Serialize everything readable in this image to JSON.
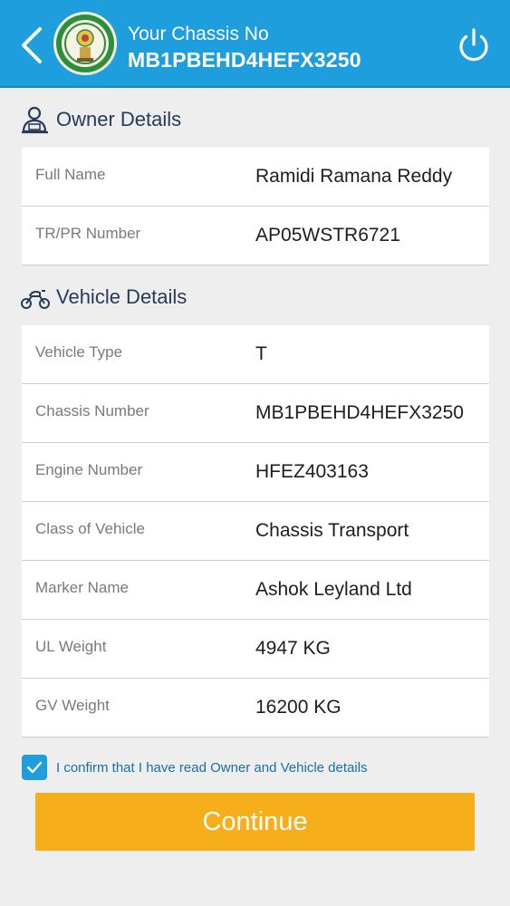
{
  "header": {
    "title": "Your Chassis No",
    "chassis_no": "MB1PBEHD4HEFX3250",
    "back_icon": "chevron-left-icon",
    "power_icon": "power-icon",
    "logo": "government-emblem-logo"
  },
  "owner": {
    "title": "Owner Details",
    "icon": "person-icon",
    "rows": [
      {
        "label": "Full Name",
        "value": "Ramidi Ramana Reddy"
      },
      {
        "label": "TR/PR Number",
        "value": "AP05WSTR6721"
      }
    ]
  },
  "vehicle": {
    "title": "Vehicle Details",
    "icon": "scooter-icon",
    "rows": [
      {
        "label": "Vehicle Type",
        "value": "T"
      },
      {
        "label": "Chassis Number",
        "value": "MB1PBEHD4HEFX3250"
      },
      {
        "label": "Engine Number",
        "value": "HFEZ403163"
      },
      {
        "label": "Class of Vehicle",
        "value": "Chassis Transport"
      },
      {
        "label": "Marker Name",
        "value": "Ashok Leyland Ltd"
      },
      {
        "label": "UL Weight",
        "value": "4947 KG"
      },
      {
        "label": "GV Weight",
        "value": "16200 KG"
      }
    ]
  },
  "confirm": {
    "checked": true,
    "text": "I confirm that I have read Owner and Vehicle details"
  },
  "continue_label": "Continue",
  "colors": {
    "header_bg": "#1f9ede",
    "button_bg": "#f6ae1a",
    "page_bg": "#eeeeee"
  }
}
